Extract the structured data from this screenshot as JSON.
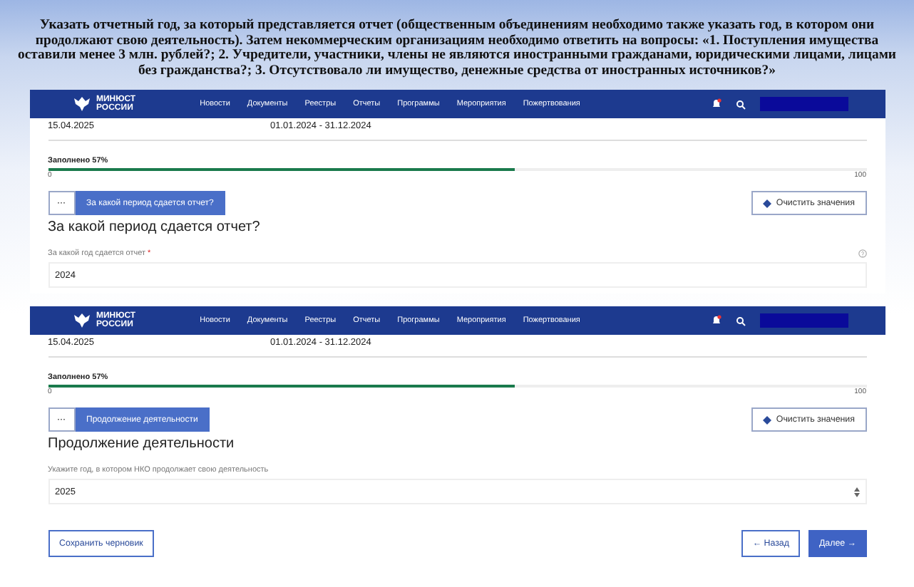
{
  "instruction": {
    "lines": [
      "Указать отчетный год, за который представляется отчет (общественным объединениям необходимо  также указать год, в котором они",
      "продолжают свою деятельность). Затем некоммерческим организациям необходимо ответить на вопросы: «1. Поступления имущества",
      "оставили менее 3 млн. рублей?; 2. Учредители, участники, члены  не являются иностранными гражданами, юридическими лицами,  лицами",
      "без гражданства?; 3. Отсутствовало ли имущество, денежные средства от иностранных источников?»"
    ]
  },
  "screenshots": [
    {
      "navbar": {
        "logo": [
          "МИНЮСТ",
          "РОССИИ"
        ],
        "links": [
          "Новости",
          "Документы",
          "Реестры",
          "Отчеты",
          "Программы",
          "Мероприятия",
          "Пожертвования"
        ],
        "notification": true
      },
      "report_date": "15.04.2025",
      "report_period": "01.01.2024 - 31.12.2024",
      "progress": {
        "label": "Заполнено 57%",
        "level": 0.57,
        "min": "0",
        "max": "100"
      },
      "step": {
        "menu": "···",
        "title": "За какой период сдается отчет?"
      },
      "clear_button": "Очистить значения",
      "heading": "За какой период сдается отчет?",
      "field": {
        "kind": "text",
        "label": "За какой год сдается отчет",
        "required_mark": "*",
        "value": "2024",
        "help": true
      }
    },
    {
      "navbar": {
        "logo": [
          "МИНЮСТ",
          "РОССИИ"
        ],
        "links": [
          "Новости",
          "Документы",
          "Реестры",
          "Отчеты",
          "Программы",
          "Мероприятия",
          "Пожертвования"
        ],
        "notification": true
      },
      "report_date": "15.04.2025",
      "report_period": "01.01.2024 - 31.12.2024",
      "progress": {
        "label": "Заполнено 57%",
        "level": 0.57,
        "min": "0",
        "max": "100"
      },
      "step": {
        "menu": "···",
        "title": "Продолжение деятельности"
      },
      "clear_button": "Очистить значения",
      "heading": "Продолжение деятельности",
      "field": {
        "kind": "number",
        "label": "Укажите год, в котором НКО продолжает свою деятельность",
        "value": "2025",
        "help": false
      },
      "footer": {
        "save": "Сохранить черновик",
        "back_arrow": "←",
        "back": "Назад",
        "next": "Далее",
        "next_arrow": "→"
      }
    }
  ]
}
